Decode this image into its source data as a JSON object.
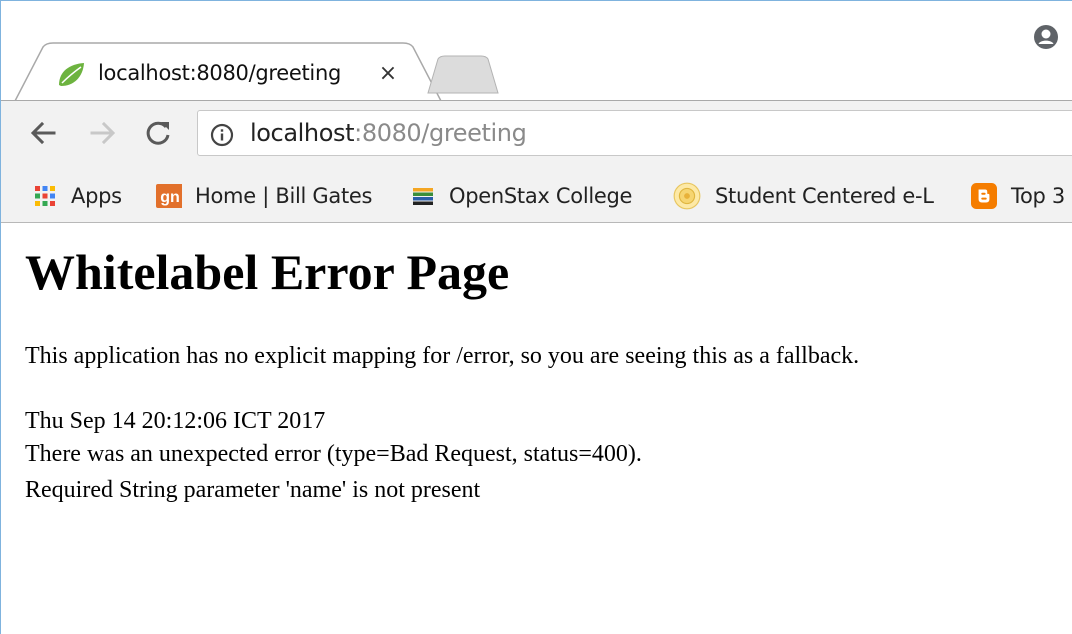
{
  "tab": {
    "title": "localhost:8080/greeting",
    "close_glyph": "×",
    "favicon": "spring-leaf-icon"
  },
  "toolbar": {
    "back": "back-arrow-icon",
    "forward": "forward-arrow-icon",
    "reload": "reload-icon",
    "url_host": "localhost",
    "url_rest": ":8080/greeting"
  },
  "bookmarks": [
    {
      "label": "Apps",
      "icon": "apps-grid-icon"
    },
    {
      "label": "Home | Bill Gates",
      "icon": "gn-icon",
      "icon_text": "gn"
    },
    {
      "label": "OpenStax College",
      "icon": "openstax-icon"
    },
    {
      "label": "Student Centered e-L",
      "icon": "seal-icon"
    },
    {
      "label": "Top 3",
      "icon": "blogger-icon"
    }
  ],
  "page": {
    "heading": "Whitelabel Error Page",
    "message": "This application has no explicit mapping for /error, so you are seeing this as a fallback.",
    "timestamp": "Thu Sep 14 20:12:06 ICT 2017",
    "error_line": "There was an unexpected error (type=Bad Request, status=400).",
    "detail_line": "Required String parameter 'name' is not present"
  },
  "colors": {
    "window_border": "#7fb3de",
    "toolbar_bg": "#f2f2f2",
    "gn_orange": "#e2702b",
    "blogger_orange": "#f57d00",
    "spring_green": "#6db33f"
  }
}
